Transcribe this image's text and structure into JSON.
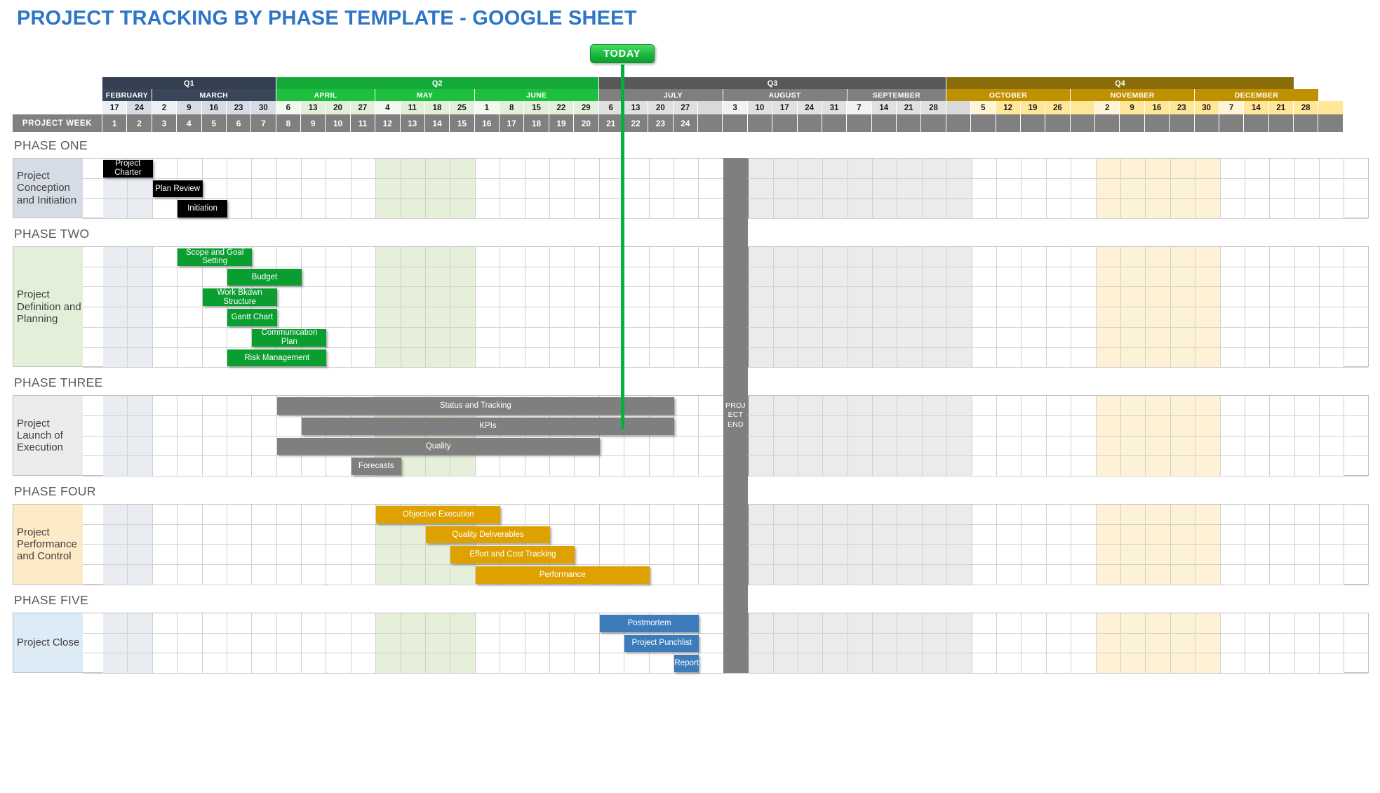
{
  "title": "PROJECT TRACKING BY PHASE TEMPLATE - GOOGLE SHEET",
  "today_label": "TODAY",
  "project_end_label": "PROJECT END",
  "week_row_label": "PROJECT WEEK",
  "colors": {
    "title": "#2E75C8",
    "q1": "#343f52",
    "q2": "#16ab39",
    "q3": "#585858",
    "q4": "#8a6d09",
    "bar_black": "#000000",
    "bar_green": "#0a9d30",
    "bar_gray": "#7f7f7f",
    "bar_orange": "#dfa100",
    "bar_blue": "#3d7cbb",
    "today": "#00b33c"
  },
  "quarters": [
    {
      "label": "Q1",
      "span": 7,
      "cls": "q1"
    },
    {
      "label": "Q2",
      "span": 13,
      "cls": "q2"
    },
    {
      "label": "Q3",
      "span": 14,
      "cls": "q3"
    },
    {
      "label": "Q4",
      "span": 14,
      "cls": "q4"
    }
  ],
  "months": [
    {
      "label": "FEBRUARY",
      "span": 2,
      "cls": "m-q1"
    },
    {
      "label": "MARCH",
      "span": 5,
      "cls": "m-q1"
    },
    {
      "label": "APRIL",
      "span": 4,
      "cls": "m-q2"
    },
    {
      "label": "MAY",
      "span": 4,
      "cls": "m-q2"
    },
    {
      "label": "JUNE",
      "span": 5,
      "cls": "m-q2"
    },
    {
      "label": "",
      "span": 1,
      "cls": "m-q3"
    },
    {
      "label": "JULY",
      "span": 4,
      "cls": "m-q3"
    },
    {
      "label": "AUGUST",
      "span": 5,
      "cls": "m-q3"
    },
    {
      "label": "SEPTEMBER",
      "span": 4,
      "cls": "m-q3"
    },
    {
      "label": "OCTOBER",
      "span": 5,
      "cls": "m-q4"
    },
    {
      "label": "NOVEMBER",
      "span": 5,
      "cls": "m-q4"
    },
    {
      "label": "DECEMBER",
      "span": 5,
      "cls": "m-q4"
    }
  ],
  "day_cells": [
    {
      "d": "17",
      "cls": "d-q1f"
    },
    {
      "d": "24",
      "cls": "d-q1"
    },
    {
      "d": "2",
      "cls": "d-q1f"
    },
    {
      "d": "9",
      "cls": "d-q1"
    },
    {
      "d": "16",
      "cls": "d-q1"
    },
    {
      "d": "23",
      "cls": "d-q1"
    },
    {
      "d": "30",
      "cls": "d-q1"
    },
    {
      "d": "6",
      "cls": "d-q2f"
    },
    {
      "d": "13",
      "cls": "d-q2"
    },
    {
      "d": "20",
      "cls": "d-q2"
    },
    {
      "d": "27",
      "cls": "d-q2"
    },
    {
      "d": "4",
      "cls": "d-q2f"
    },
    {
      "d": "11",
      "cls": "d-q2"
    },
    {
      "d": "18",
      "cls": "d-q2"
    },
    {
      "d": "25",
      "cls": "d-q2"
    },
    {
      "d": "1",
      "cls": "d-q2f"
    },
    {
      "d": "8",
      "cls": "d-q2"
    },
    {
      "d": "15",
      "cls": "d-q2"
    },
    {
      "d": "22",
      "cls": "d-q2"
    },
    {
      "d": "29",
      "cls": "d-q2"
    },
    {
      "d": "6",
      "cls": "d-q3"
    },
    {
      "d": "13",
      "cls": "d-q3"
    },
    {
      "d": "20",
      "cls": "d-q3"
    },
    {
      "d": "27",
      "cls": "d-q3"
    },
    {
      "d": "",
      "cls": "d-blank"
    },
    {
      "d": "3",
      "cls": "d-q3f"
    },
    {
      "d": "10",
      "cls": "d-q3"
    },
    {
      "d": "17",
      "cls": "d-q3"
    },
    {
      "d": "24",
      "cls": "d-q3"
    },
    {
      "d": "31",
      "cls": "d-q3"
    },
    {
      "d": "7",
      "cls": "d-q3f"
    },
    {
      "d": "14",
      "cls": "d-q3"
    },
    {
      "d": "21",
      "cls": "d-q3"
    },
    {
      "d": "28",
      "cls": "d-q3"
    },
    {
      "d": "",
      "cls": "d-blank"
    },
    {
      "d": "5",
      "cls": "d-q4f"
    },
    {
      "d": "12",
      "cls": "d-q4"
    },
    {
      "d": "19",
      "cls": "d-q4"
    },
    {
      "d": "26",
      "cls": "d-q4"
    },
    {
      "d": "",
      "cls": "d-q4"
    },
    {
      "d": "2",
      "cls": "d-q4f"
    },
    {
      "d": "9",
      "cls": "d-q4"
    },
    {
      "d": "16",
      "cls": "d-q4"
    },
    {
      "d": "23",
      "cls": "d-q4"
    },
    {
      "d": "30",
      "cls": "d-q4"
    },
    {
      "d": "7",
      "cls": "d-q4f"
    },
    {
      "d": "14",
      "cls": "d-q4"
    },
    {
      "d": "21",
      "cls": "d-q4"
    },
    {
      "d": "28",
      "cls": "d-q4"
    },
    {
      "d": "",
      "cls": "d-q4"
    }
  ],
  "project_weeks": [
    "1",
    "2",
    "3",
    "4",
    "5",
    "6",
    "7",
    "8",
    "9",
    "10",
    "11",
    "12",
    "13",
    "14",
    "15",
    "16",
    "17",
    "18",
    "19",
    "20",
    "21",
    "22",
    "23",
    "24"
  ],
  "today_week": 21,
  "project_end_week": 25,
  "phases": [
    {
      "title": "PHASE ONE",
      "name": "Project Conception and Initiation",
      "name_cls": "pn-p1",
      "rows": 3,
      "tasks": [
        {
          "label": "Project Charter",
          "start": 1,
          "end": 2,
          "row": 0,
          "color": "black"
        },
        {
          "label": "Plan Review",
          "start": 3,
          "end": 4,
          "row": 1,
          "color": "black"
        },
        {
          "label": "Initiation",
          "start": 4,
          "end": 5,
          "row": 2,
          "color": "black"
        }
      ]
    },
    {
      "title": "PHASE TWO",
      "name": "Project Definition and Planning",
      "name_cls": "pn-p2",
      "rows": 6,
      "tasks": [
        {
          "label": "Scope and Goal Setting",
          "start": 4,
          "end": 6,
          "row": 0,
          "color": "green"
        },
        {
          "label": "Budget",
          "start": 6,
          "end": 8,
          "row": 1,
          "color": "green"
        },
        {
          "label": "Work Bkdwn Structure",
          "start": 5,
          "end": 7,
          "row": 2,
          "color": "green"
        },
        {
          "label": "Gantt Chart",
          "start": 6,
          "end": 7,
          "row": 3,
          "color": "green"
        },
        {
          "label": "Communication Plan",
          "start": 7,
          "end": 9,
          "row": 4,
          "color": "green"
        },
        {
          "label": "Risk Management",
          "start": 6,
          "end": 9,
          "row": 5,
          "color": "green"
        }
      ]
    },
    {
      "title": "PHASE THREE",
      "name": "Project Launch of Execution",
      "name_cls": "pn-p3",
      "rows": 4,
      "tasks": [
        {
          "label": "Status  and Tracking",
          "start": 8,
          "end": 23,
          "row": 0,
          "color": "gray"
        },
        {
          "label": "KPIs",
          "start": 9,
          "end": 23,
          "row": 1,
          "color": "gray"
        },
        {
          "label": "Quality",
          "start": 8,
          "end": 20,
          "row": 2,
          "color": "gray"
        },
        {
          "label": "Forecasts",
          "start": 11,
          "end": 12,
          "row": 3,
          "color": "gray"
        }
      ]
    },
    {
      "title": "PHASE FOUR",
      "name": "Project Performance and Control",
      "name_cls": "pn-p4",
      "rows": 4,
      "tasks": [
        {
          "label": "Objective Execution",
          "start": 12,
          "end": 16,
          "row": 0,
          "color": "orange"
        },
        {
          "label": "Quality Deliverables",
          "start": 14,
          "end": 18,
          "row": 1,
          "color": "orange"
        },
        {
          "label": "Effort and Cost Tracking",
          "start": 15,
          "end": 19,
          "row": 2,
          "color": "orange"
        },
        {
          "label": "Performance",
          "start": 16,
          "end": 22,
          "row": 3,
          "color": "orange"
        }
      ]
    },
    {
      "title": "PHASE FIVE",
      "name": "Project Close",
      "name_cls": "pn-p5",
      "rows": 3,
      "tasks": [
        {
          "label": "Postmortem",
          "start": 21,
          "end": 24,
          "row": 0,
          "color": "blue"
        },
        {
          "label": "Project Punchlist",
          "start": 22,
          "end": 24,
          "row": 1,
          "color": "blue"
        },
        {
          "label": "Report",
          "start": 24,
          "end": 24,
          "row": 2,
          "color": "blue"
        }
      ]
    }
  ]
}
